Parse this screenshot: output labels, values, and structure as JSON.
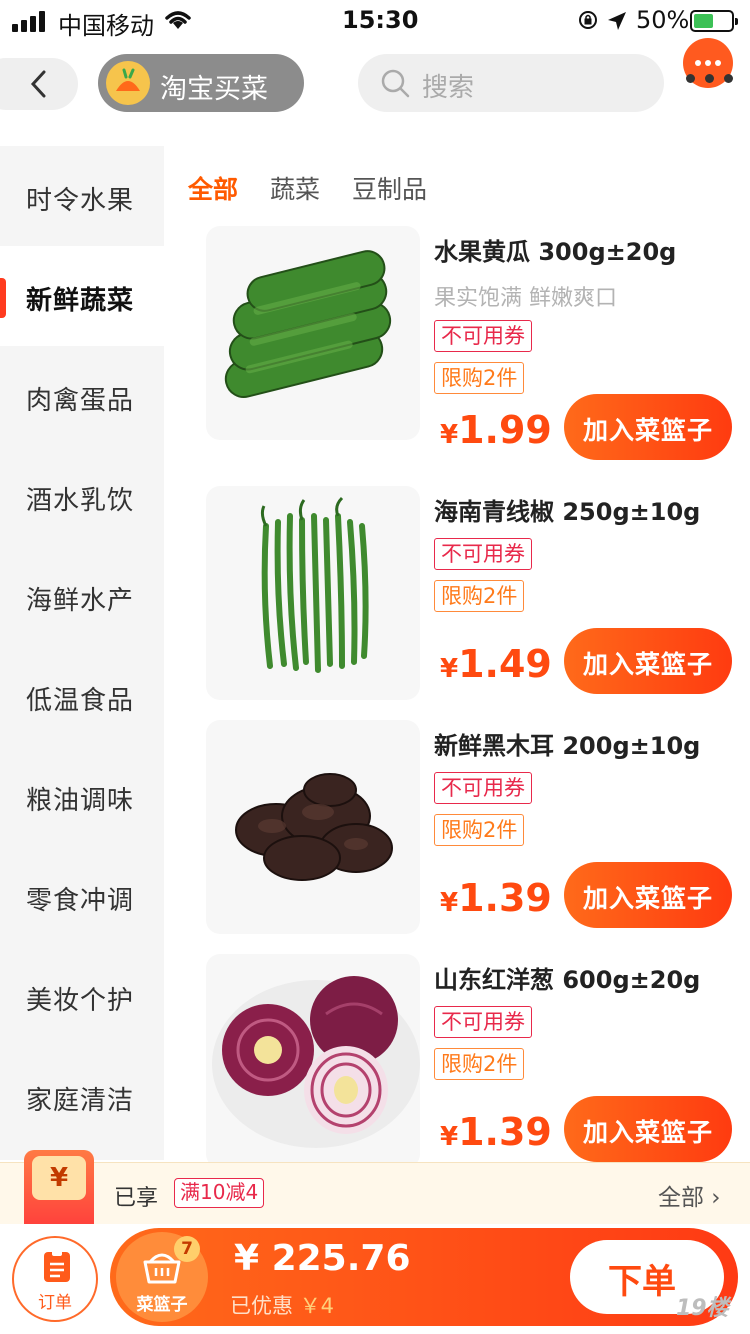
{
  "status_bar": {
    "carrier": "中国移动",
    "time": "15:30",
    "battery": "50%",
    "battery_level": 0.5
  },
  "header": {
    "brand": "淘宝买菜",
    "search_placeholder": "搜索"
  },
  "sidebar": {
    "items": [
      {
        "label": "时令水果"
      },
      {
        "label": "新鲜蔬菜",
        "active": true
      },
      {
        "label": "肉禽蛋品"
      },
      {
        "label": "酒水乳饮"
      },
      {
        "label": "海鲜水产"
      },
      {
        "label": "低温食品"
      },
      {
        "label": "粮油调味"
      },
      {
        "label": "零食冲调"
      },
      {
        "label": "美妆个护"
      },
      {
        "label": "家庭清洁"
      }
    ]
  },
  "tabs": [
    {
      "label": "全部",
      "active": true
    },
    {
      "label": "蔬菜"
    },
    {
      "label": "豆制品"
    }
  ],
  "products": [
    {
      "name": "水果黄瓜 300g±20g",
      "desc": "果实饱满 鲜嫩爽口",
      "tag_coupon": "不可用券",
      "tag_limit": "限购2件",
      "currency": "¥",
      "price": "1.99",
      "button": "加入菜篮子"
    },
    {
      "name": "海南青线椒  250g±10g",
      "desc": "",
      "tag_coupon": "不可用券",
      "tag_limit": "限购2件",
      "currency": "¥",
      "price": "1.49",
      "button": "加入菜篮子"
    },
    {
      "name": "新鲜黑木耳 200g±10g",
      "desc": "",
      "tag_coupon": "不可用券",
      "tag_limit": "限购2件",
      "currency": "¥",
      "price": "1.39",
      "button": "加入菜篮子"
    },
    {
      "name": "山东红洋葱 600g±20g",
      "desc": "",
      "tag_coupon": "不可用券",
      "tag_limit": "限购2件",
      "currency": "¥",
      "price": "1.39",
      "button": "加入菜篮子"
    }
  ],
  "discount_bar": {
    "coin": "¥",
    "enjoyed": "已享",
    "promo": "满10减4",
    "all": "全部 ›"
  },
  "bottom_bar": {
    "order": "订单",
    "basket": "菜篮子",
    "basket_count": "7",
    "total": "¥ 225.76",
    "saved_label": "已优惠",
    "saved_amount": "￥4",
    "checkout": "下单",
    "watermark": "19楼"
  },
  "colors": {
    "accent": "#ff4a10",
    "brand_gray": "#8c8c8c",
    "coupon_tag": "#e8294b",
    "limit_tag": "#ff7a1a"
  }
}
